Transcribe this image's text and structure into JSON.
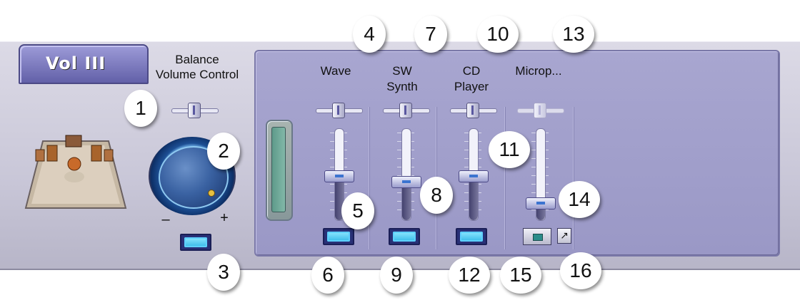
{
  "tab": {
    "label": "Vol III"
  },
  "balance": {
    "label_line1": "Balance",
    "label_line2": "Volume Control",
    "minus": "–",
    "plus": "+"
  },
  "channels": [
    {
      "label_line1": "Wave",
      "label_line2": "",
      "volume_level": 0.47
    },
    {
      "label_line1": "SW",
      "label_line2": "Synth",
      "volume_level": 0.4
    },
    {
      "label_line1": "CD",
      "label_line2": "Player",
      "volume_level": 0.47
    },
    {
      "label_line1": "Microp...",
      "label_line2": "",
      "volume_level": 0.13
    }
  ],
  "callouts": [
    "1",
    "2",
    "3",
    "4",
    "5",
    "6",
    "7",
    "8",
    "9",
    "10",
    "11",
    "12",
    "13",
    "14",
    "15",
    "16"
  ],
  "colors": {
    "panel": "#9a98c6",
    "tab": "#6260a8",
    "mute_glow": "#34b8e8"
  }
}
